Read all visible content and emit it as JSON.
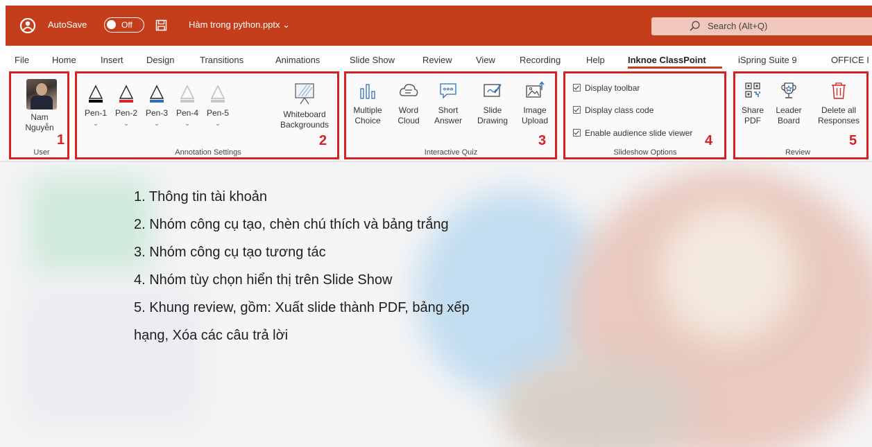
{
  "titlebar": {
    "autosave_label": "AutoSave",
    "autosave_state": "Off",
    "file_name": "Hàm trong python.pptx",
    "file_chevron": "⌄",
    "search_placeholder": "Search (Alt+Q)",
    "color": "#c43e1c"
  },
  "menu": {
    "tabs": [
      "File",
      "Home",
      "Insert",
      "Design",
      "Transitions",
      "Animations",
      "Slide Show",
      "Review",
      "View",
      "Recording",
      "Help",
      "Inknoe ClassPoint",
      "iSpring Suite 9",
      "OFFICE I"
    ],
    "active": "Inknoe ClassPoint"
  },
  "ribbon": {
    "user": {
      "name_line1": "Nam",
      "name_line2": "Nguyễn",
      "title": "User",
      "number": "1"
    },
    "annotation": {
      "pens": [
        {
          "label": "Pen-1",
          "color": "#000000"
        },
        {
          "label": "Pen-2",
          "color": "#d9232d"
        },
        {
          "label": "Pen-3",
          "color": "#2f6fb7"
        },
        {
          "label": "Pen-4",
          "color": "#c8c8c8"
        },
        {
          "label": "Pen-5",
          "color": "#c8c8c8"
        }
      ],
      "caret": "⌄",
      "whiteboard_line1": "Whiteboard",
      "whiteboard_line2": "Backgrounds",
      "title": "Annotation Settings",
      "number": "2"
    },
    "quiz": {
      "buttons": [
        {
          "line1": "Multiple",
          "line2": "Choice",
          "icon": "bar-chart-icon"
        },
        {
          "line1": "Word",
          "line2": "Cloud",
          "icon": "cloud-icon"
        },
        {
          "line1": "Short",
          "line2": "Answer",
          "icon": "speech-bubble-icon"
        },
        {
          "line1": "Slide",
          "line2": "Drawing",
          "icon": "drawing-icon"
        },
        {
          "line1": "Image",
          "line2": "Upload",
          "icon": "image-upload-icon"
        }
      ],
      "title": "Interactive Quiz",
      "number": "3"
    },
    "slideshow": {
      "options": [
        "Display toolbar",
        "Display class code",
        "Enable audience slide viewer"
      ],
      "title": "Slideshow Options",
      "number": "4"
    },
    "review": {
      "buttons": [
        {
          "line1": "Share",
          "line2": "PDF",
          "icon": "qr-share-icon"
        },
        {
          "line1": "Leader",
          "line2": "Board",
          "icon": "trophy-icon"
        },
        {
          "line1": "Delete all",
          "line2": "Responses",
          "icon": "trash-icon"
        }
      ],
      "title": "Review",
      "number": "5"
    },
    "highlight_color": "#d62021"
  },
  "slide": {
    "items": [
      "1. Thông tin tài khoản",
      "2. Nhóm công cụ tạo, chèn chú thích và bảng trắng",
      "3. Nhóm công cụ tạo tương tác",
      "4. Nhóm tùy chọn hiển thị trên Slide Show",
      "5. Khung review, gồm: Xuất slide thành PDF, bảng xếp",
      "hạng, Xóa các câu trả lời"
    ]
  }
}
